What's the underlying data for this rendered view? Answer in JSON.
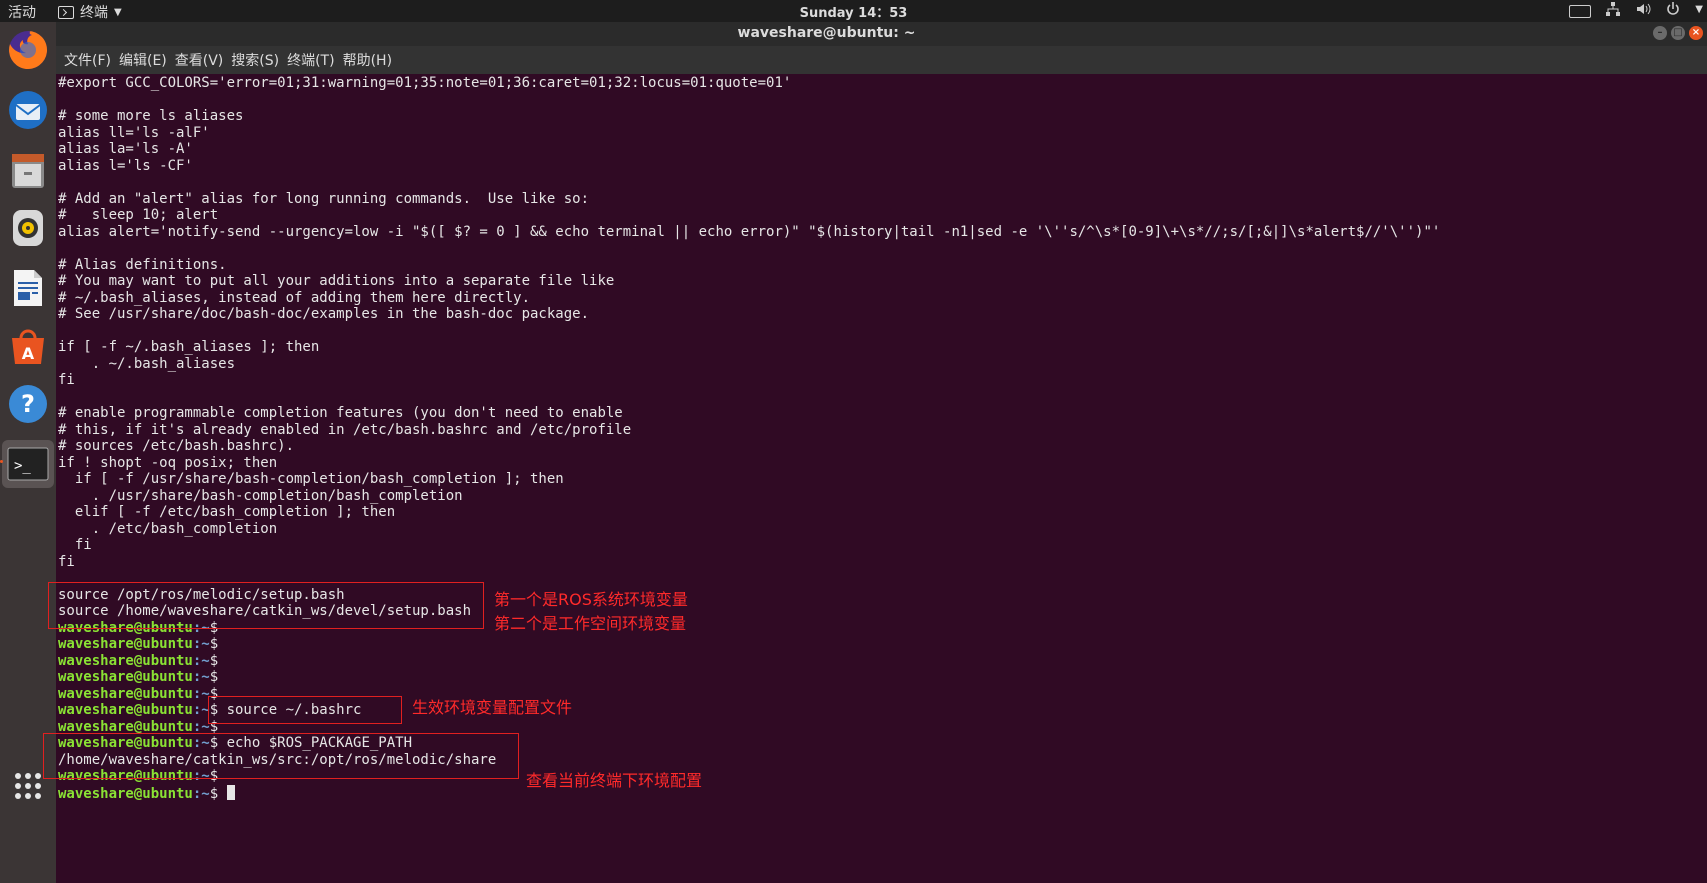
{
  "topbar": {
    "activities": "活动",
    "app_name": "终端",
    "clock": "Sunday 14：53"
  },
  "window": {
    "title": "waveshare@ubuntu: ~",
    "menu": [
      "文件(F)",
      "编辑(E)",
      "查看(V)",
      "搜索(S)",
      "终端(T)",
      "帮助(H)"
    ]
  },
  "dock": {
    "items": [
      "firefox-icon",
      "thunderbird-icon",
      "files-icon",
      "rhythmbox-icon",
      "writer-icon",
      "software-icon",
      "help-icon",
      "terminal-icon",
      "show-apps-icon"
    ],
    "accent": "#e95420"
  },
  "terminal": {
    "prompt_user": "waveshare@ubuntu",
    "prompt_path": ":~",
    "prompt_suffix": "$ ",
    "lines": [
      {
        "t": "#export GCC_COLORS='error=01;31:warning=01;35:note=01;36:caret=01;32:locus=01:quote=01'"
      },
      {
        "t": ""
      },
      {
        "t": "# some more ls aliases"
      },
      {
        "t": "alias ll='ls -alF'"
      },
      {
        "t": "alias la='ls -A'"
      },
      {
        "t": "alias l='ls -CF'"
      },
      {
        "t": ""
      },
      {
        "t": "# Add an \"alert\" alias for long running commands.  Use like so:"
      },
      {
        "t": "#   sleep 10; alert"
      },
      {
        "t": "alias alert='notify-send --urgency=low -i \"$([ $? = 0 ] && echo terminal || echo error)\" \"$(history|tail -n1|sed -e '\\''s/^\\s*[0-9]\\+\\s*//;s/[;&|]\\s*alert$//'\\'')\"'"
      },
      {
        "t": ""
      },
      {
        "t": "# Alias definitions."
      },
      {
        "t": "# You may want to put all your additions into a separate file like"
      },
      {
        "t": "# ~/.bash_aliases, instead of adding them here directly."
      },
      {
        "t": "# See /usr/share/doc/bash-doc/examples in the bash-doc package."
      },
      {
        "t": ""
      },
      {
        "t": "if [ -f ~/.bash_aliases ]; then"
      },
      {
        "t": "    . ~/.bash_aliases"
      },
      {
        "t": "fi"
      },
      {
        "t": ""
      },
      {
        "t": "# enable programmable completion features (you don't need to enable"
      },
      {
        "t": "# this, if it's already enabled in /etc/bash.bashrc and /etc/profile"
      },
      {
        "t": "# sources /etc/bash.bashrc)."
      },
      {
        "t": "if ! shopt -oq posix; then"
      },
      {
        "t": "  if [ -f /usr/share/bash-completion/bash_completion ]; then"
      },
      {
        "t": "    . /usr/share/bash-completion/bash_completion"
      },
      {
        "t": "  elif [ -f /etc/bash_completion ]; then"
      },
      {
        "t": "    . /etc/bash_completion"
      },
      {
        "t": "  fi"
      },
      {
        "t": "fi"
      },
      {
        "t": ""
      },
      {
        "t": "source /opt/ros/melodic/setup.bash"
      },
      {
        "t": "source /home/waveshare/catkin_ws/devel/setup.bash"
      },
      {
        "p": true,
        "t": ""
      },
      {
        "p": true,
        "t": ""
      },
      {
        "p": true,
        "t": ""
      },
      {
        "p": true,
        "t": ""
      },
      {
        "p": true,
        "t": ""
      },
      {
        "p": true,
        "t": "source ~/.bashrc"
      },
      {
        "p": true,
        "t": ""
      },
      {
        "p": true,
        "t": "echo $ROS_PACKAGE_PATH"
      },
      {
        "t": "/home/waveshare/catkin_ws/src:/opt/ros/melodic/share"
      },
      {
        "p": true,
        "t": ""
      },
      {
        "p": true,
        "t": "",
        "cursor": true
      }
    ]
  },
  "annotations": {
    "note1": "第一个是ROS系统环境变量",
    "note2": "第二个是工作空间环境变量",
    "note3": "生效环境变量配置文件",
    "note4": "查看当前终端下环境配置",
    "color": "#ff2a2a"
  }
}
